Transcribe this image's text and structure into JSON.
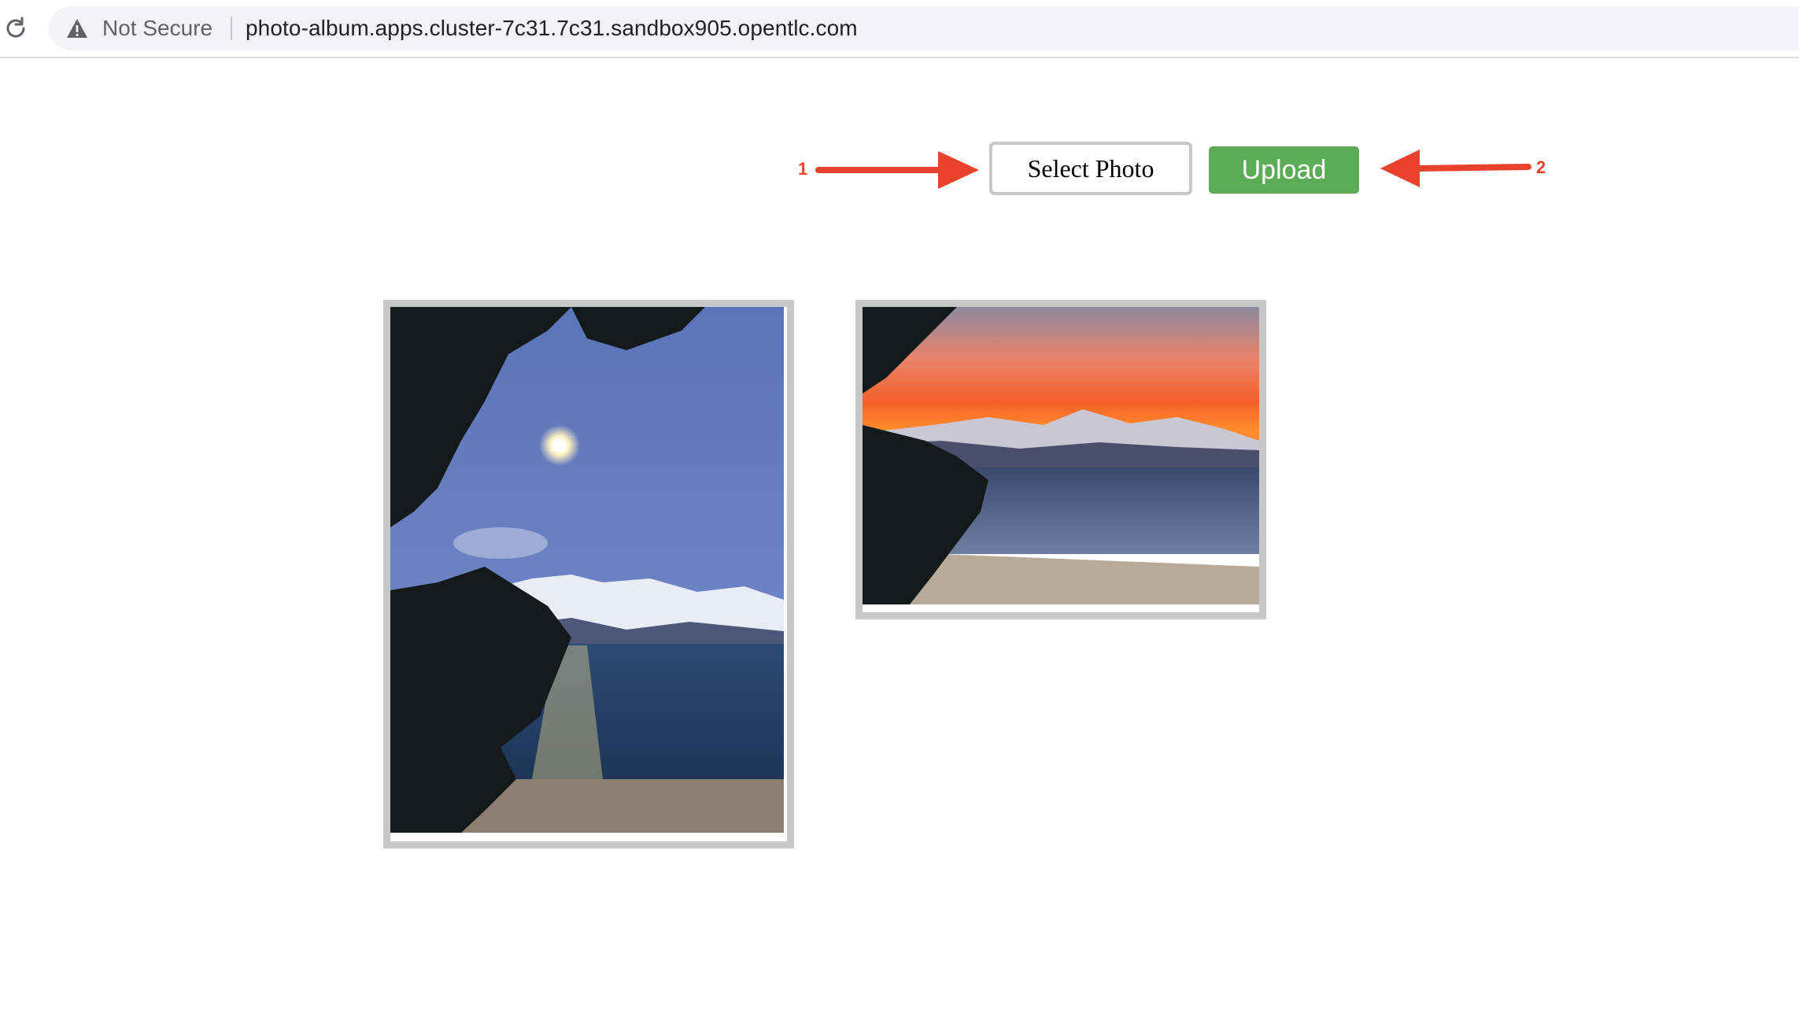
{
  "browser": {
    "security_label": "Not Secure",
    "url": "photo-album.apps.cluster-7c31.7c31.sandbox905.opentlc.com"
  },
  "annotations": {
    "step1": "1",
    "step2": "2",
    "arrow_color": "#e8412c"
  },
  "controls": {
    "select_photo_label": "Select Photo",
    "upload_label": "Upload",
    "upload_color": "#5cac57"
  },
  "photos": [
    {
      "subject": "moon-over-lake-icon"
    },
    {
      "subject": "sunset-over-lake-icon"
    }
  ]
}
